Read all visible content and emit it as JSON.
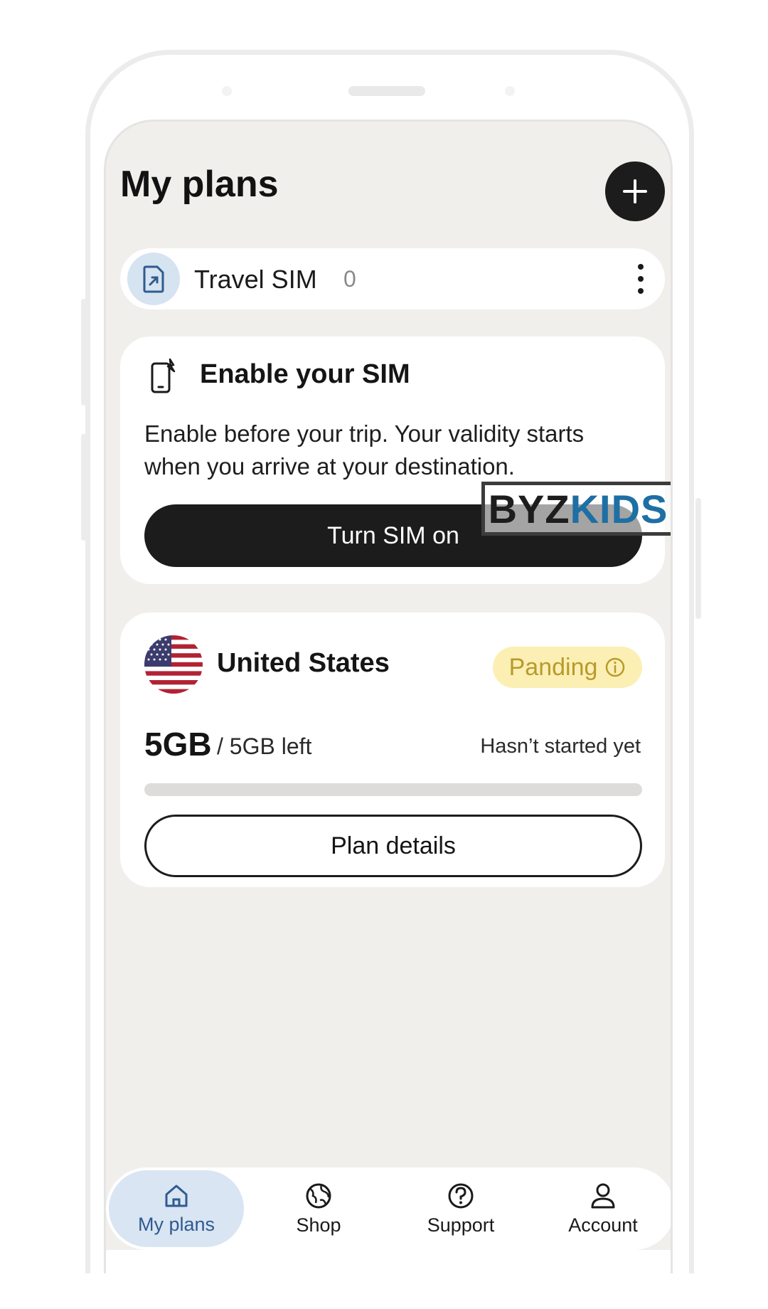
{
  "header": {
    "title": "My plans"
  },
  "sim": {
    "label": "Travel SIM",
    "count": "0"
  },
  "enable_card": {
    "title": "Enable your SIM",
    "description": "Enable before your trip. Your validity starts when you arrive at your destination.",
    "button_label": "Turn SIM on"
  },
  "watermark": {
    "part1": "BYZ",
    "part2": "KIDS"
  },
  "plan": {
    "country": "United States",
    "status": "Panding",
    "data_amount": "5GB",
    "data_left": "/ 5GB left",
    "start_status": "Hasn’t started yet",
    "progress_fraction": 0.0,
    "details_button": "Plan details"
  },
  "nav": {
    "items": [
      {
        "label": "My plans",
        "icon": "home-icon",
        "active": true
      },
      {
        "label": "Shop",
        "icon": "globe-icon",
        "active": false
      },
      {
        "label": "Support",
        "icon": "help-icon",
        "active": false
      },
      {
        "label": "Account",
        "icon": "account-icon",
        "active": false
      }
    ]
  },
  "colors": {
    "background": "#f1efeb",
    "accent_dark": "#1c1c1c",
    "badge_bg": "#fbefb4",
    "badge_text": "#b99a2c",
    "nav_active_bg": "#d9e5f3"
  }
}
